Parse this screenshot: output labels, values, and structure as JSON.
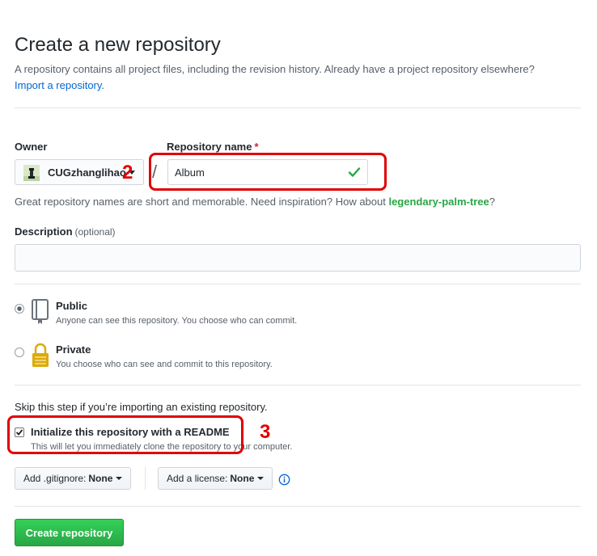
{
  "header": {
    "title": "Create a new repository",
    "subtitle": "A repository contains all project files, including the revision history. Already have a project repository elsewhere?",
    "import_link": "Import a repository."
  },
  "owner": {
    "label": "Owner",
    "value": "CUGzhanglihao"
  },
  "repo_name": {
    "label": "Repository name",
    "required_mark": "*",
    "value": "Album",
    "slash": "/"
  },
  "hint": {
    "prefix": "Great repository names are short and memorable. Need inspiration? How about ",
    "suggestion": "legendary-palm-tree",
    "suffix": "?"
  },
  "description": {
    "label": "Description",
    "optional": "(optional)",
    "value": ""
  },
  "visibility": {
    "selected": "public",
    "public": {
      "title": "Public",
      "desc": "Anyone can see this repository. You choose who can commit."
    },
    "private": {
      "title": "Private",
      "desc": "You choose who can see and commit to this repository."
    }
  },
  "init": {
    "skip_text": "Skip this step if you’re importing an existing repository.",
    "readme_title": "Initialize this repository with a README",
    "readme_desc": "This will let you immediately clone the repository to your computer.",
    "readme_checked": true
  },
  "gitignore": {
    "label": "Add .gitignore:",
    "value": "None"
  },
  "license": {
    "label": "Add a license:",
    "value": "None"
  },
  "create_button": "Create repository",
  "annotations": {
    "two": "2",
    "three": "3"
  },
  "colors": {
    "link": "#0366d6",
    "success": "#28a745",
    "annotation": "#e00000",
    "required": "#cb2431"
  }
}
